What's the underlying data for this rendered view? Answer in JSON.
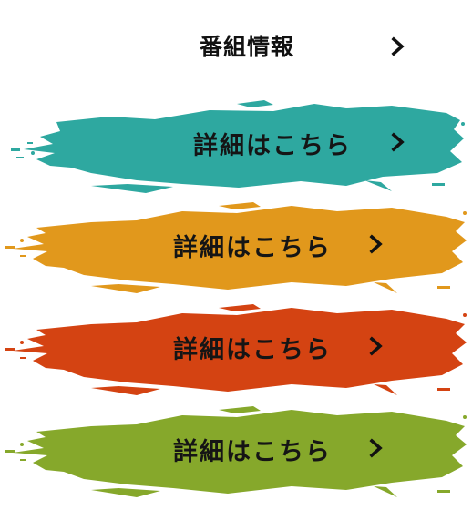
{
  "program_info": {
    "label": "番組情報",
    "chevron_icon": "chevron-right-icon"
  },
  "detail_buttons": [
    {
      "label": "詳細はこちら",
      "color": "#2ea8a0",
      "chevron_icon": "chevron-right-icon"
    },
    {
      "label": "詳細はこちら",
      "color": "#e1981c",
      "chevron_icon": "chevron-right-icon"
    },
    {
      "label": "詳細はこちら",
      "color": "#d44312",
      "chevron_icon": "chevron-right-icon"
    },
    {
      "label": "詳細はこちら",
      "color": "#86a82b",
      "chevron_icon": "chevron-right-icon"
    }
  ]
}
